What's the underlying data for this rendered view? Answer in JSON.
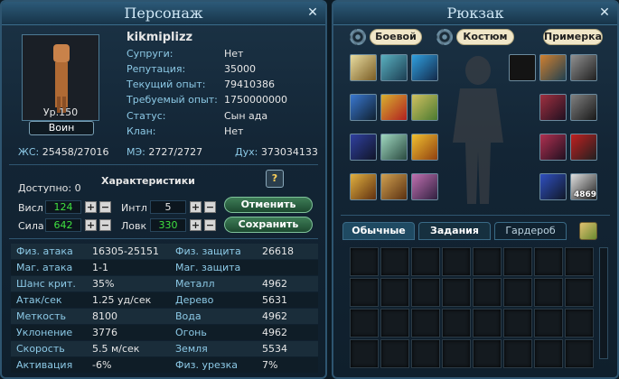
{
  "character": {
    "title": "Персонаж",
    "close_label": "✕",
    "name": "kikmiplizz",
    "level": "Ур.150",
    "class": "Воин",
    "info": [
      {
        "label": "Супруги:",
        "value": "Нет"
      },
      {
        "label": "Репутация:",
        "value": "35000"
      },
      {
        "label": "Текущий опыт:",
        "value": "79410386"
      },
      {
        "label": "Требуемый опыт:",
        "value": "1750000000"
      },
      {
        "label": "Статус:",
        "value": "Сын ада"
      },
      {
        "label": "Клан:",
        "value": "Нет"
      }
    ],
    "hp_label": "ЖС:",
    "hp_value": "25458/27016",
    "mp_label": "МЭ:",
    "mp_value": "2727/2727",
    "spirit_label": "Дух:",
    "spirit_value": "373034133",
    "section_title": "Характеристики",
    "help_label": "?",
    "available_label": "Доступно:",
    "available_value": "0",
    "attributes": [
      {
        "label": "Висл",
        "value": "124"
      },
      {
        "label": "Интл",
        "value": "5"
      },
      {
        "label": "Сила",
        "value": "642"
      },
      {
        "label": "Ловк",
        "value": "330"
      }
    ],
    "plus": "+",
    "minus": "−",
    "cancel_label": "Отменить",
    "save_label": "Сохранить",
    "stats": [
      {
        "l1": "Физ. атака",
        "v1": "16305-25151",
        "l2": "Физ. защита",
        "v2": "26618"
      },
      {
        "l1": "Маг. атака",
        "v1": "1-1",
        "l2": "Маг. защита",
        "v2": ""
      },
      {
        "l1": "Шанс крит.",
        "v1": "35%",
        "l2": "Металл",
        "v2": "4962"
      },
      {
        "l1": "Атак/сек",
        "v1": "1.25 уд/сек",
        "l2": "Дерево",
        "v2": "5631"
      },
      {
        "l1": "Меткость",
        "v1": "8100",
        "l2": "Вода",
        "v2": "4962"
      },
      {
        "l1": "Уклонение",
        "v1": "3776",
        "l2": "Огонь",
        "v2": "4962"
      },
      {
        "l1": "Скорость",
        "v1": "5.5 м/сек",
        "l2": "Земля",
        "v2": "5534"
      },
      {
        "l1": "Активация",
        "v1": "-6%",
        "l2": "Физ. урезка",
        "v2": "7%"
      }
    ]
  },
  "backpack": {
    "title": "Рюкзак",
    "close_label": "✕",
    "tab_combat": "Боевой",
    "tab_costume": "Костюм",
    "tab_fitting": "Примерка",
    "stack_count": "4869",
    "subtabs": [
      "Обычные",
      "Задания",
      "Гардероб"
    ],
    "colors": {
      "accent": "#3a7fa3",
      "green": "#40e040",
      "label_blue": "#8cc9e6"
    }
  }
}
